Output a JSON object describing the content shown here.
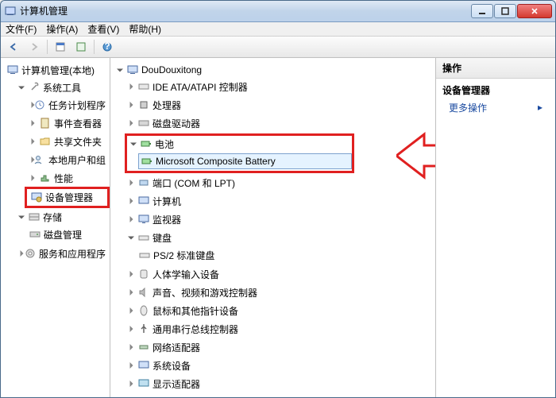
{
  "window": {
    "title": "计算机管理"
  },
  "menu": {
    "file": "文件(F)",
    "action": "操作(A)",
    "view": "查看(V)",
    "help": "帮助(H)"
  },
  "left_tree": {
    "root": "计算机管理(本地)",
    "system_tools": "系统工具",
    "task_scheduler": "任务计划程序",
    "event_viewer": "事件查看器",
    "shared_folders": "共享文件夹",
    "local_users": "本地用户和组",
    "performance": "性能",
    "device_manager": "设备管理器",
    "storage": "存储",
    "disk_mgmt": "磁盘管理",
    "services": "服务和应用程序"
  },
  "mid_tree": {
    "computer": "DouDouxitong",
    "ide": "IDE ATA/ATAPI 控制器",
    "cpu": "处理器",
    "disk": "磁盘驱动器",
    "battery": "电池",
    "battery_child": "Microsoft Composite Battery",
    "ports": "端口 (COM 和 LPT)",
    "computers": "计算机",
    "monitors": "监视器",
    "keyboards": "键盘",
    "keyboard_child": "PS/2 标准键盘",
    "hid": "人体学输入设备",
    "sound": "声音、视频和游戏控制器",
    "mice": "鼠标和其他指针设备",
    "usb": "通用串行总线控制器",
    "network": "网络适配器",
    "system_devices": "系统设备",
    "display": "显示适配器"
  },
  "right": {
    "actions": "操作",
    "section": "设备管理器",
    "more": "更多操作"
  }
}
